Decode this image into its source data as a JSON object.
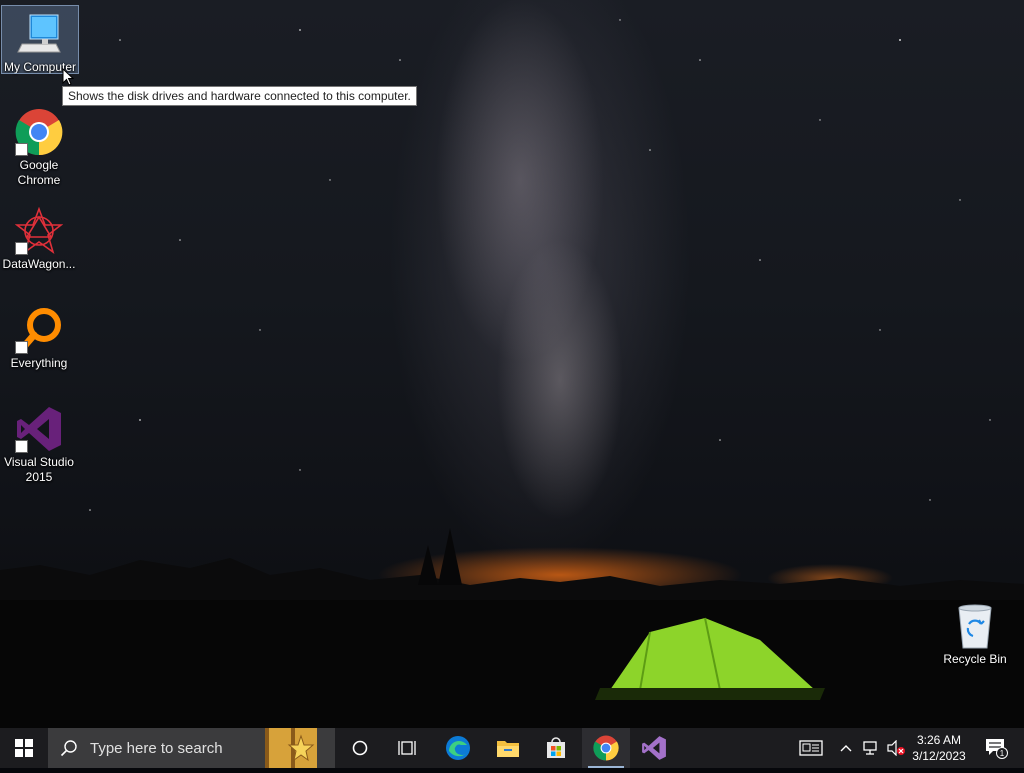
{
  "desktop": {
    "icons": [
      {
        "label": "My Computer"
      },
      {
        "label": "Google Chrome"
      },
      {
        "label": "DataWagon..."
      },
      {
        "label": "Everything"
      },
      {
        "label": "Visual Studio 2015"
      },
      {
        "label": "Recycle Bin"
      }
    ],
    "tooltip": "Shows the disk drives and hardware connected to this computer."
  },
  "taskbar": {
    "search_placeholder": "Type here to search",
    "pinned": [
      "task-view",
      "edge",
      "file-explorer",
      "store",
      "chrome",
      "visual-studio"
    ],
    "clock": {
      "time": "3:26 AM",
      "date": "3/12/2023"
    },
    "notification_count": "1"
  },
  "colors": {
    "taskbar": "#1c1c1f",
    "search": "#3b3b3d",
    "accent": "#68217a"
  }
}
